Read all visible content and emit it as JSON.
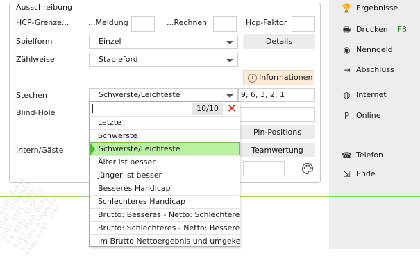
{
  "group": {
    "legend": "Ausschreibung"
  },
  "row_hcp": {
    "label": "HCP-Grenze...",
    "meldung_label": "...Meldung",
    "rechnen_label": "...Rechnen",
    "hcp_faktor_label": "Hcp-Faktor"
  },
  "spielform": {
    "label": "Spielform",
    "value": "Einzel",
    "details_button": "Details"
  },
  "zaehlweise": {
    "label": "Zählweise",
    "value": "Stableford"
  },
  "informationen_button": "Informationen",
  "stechen": {
    "label": "Stechen",
    "value": "Schwerste/Leichteste",
    "holes": "9, 6, 3, 2, 1"
  },
  "blind_hole": {
    "label": "Blind-Hole"
  },
  "pin_positions_button": "Pin-Positions",
  "intern_gaeste": {
    "label": "Intern/Gäste"
  },
  "teamwertung_button": "Teamwertung",
  "dropdown": {
    "count": "10/10",
    "close_symbol": "✕",
    "options": [
      "Letzte",
      "Schwerste",
      "Schwerste/Leichteste",
      "Älter ist besser",
      "Jünger ist besser",
      "Besseres Handicap",
      "Schlechteres Handicap",
      "Brutto: Besseres - Netto: Schlechteres H",
      "Brutto: Schlechteres - Netto: Besseres H",
      "Im Brutto Nettoergebnis und umgekehr"
    ],
    "selected_index": 2
  },
  "sidebar": {
    "items": [
      {
        "label": "Ergebnisse",
        "icon": "trophy-icon"
      },
      {
        "label": "Drucken",
        "icon": "printer-icon",
        "shortcut": "F8"
      },
      {
        "label": "Nenngeld",
        "icon": "coins-icon"
      },
      {
        "label": "Abschluss",
        "icon": "exit-box-icon"
      },
      {
        "label": "Internet",
        "icon": "globe-icon"
      },
      {
        "label": "Online",
        "icon": "online-icon"
      },
      {
        "label": "Telefon",
        "icon": "phone-icon"
      },
      {
        "label": "Ende",
        "icon": "exit-icon"
      }
    ]
  },
  "colors": {
    "accent_green": "#8fd16a",
    "selection_bg": "#b9f0a1",
    "info_bg": "#fce9d6",
    "close_red": "#dd2222",
    "shortcut_green": "#2a8a2a"
  }
}
